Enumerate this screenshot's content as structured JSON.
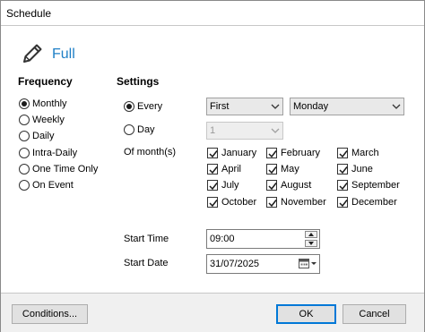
{
  "window": {
    "title": "Schedule"
  },
  "header": {
    "mode_label": "Full",
    "icon": "pencil-icon"
  },
  "frequency": {
    "heading": "Frequency",
    "selected": "Monthly",
    "options": [
      "Monthly",
      "Weekly",
      "Daily",
      "Intra-Daily",
      "One Time Only",
      "On Event"
    ]
  },
  "settings": {
    "heading": "Settings",
    "every_label": "Every",
    "day_label": "Day",
    "every_selected": true,
    "ordinal_value": "First",
    "weekday_value": "Monday",
    "day_value": "1",
    "months_label": "Of month(s)",
    "months": [
      "January",
      "February",
      "March",
      "April",
      "May",
      "June",
      "July",
      "August",
      "September",
      "October",
      "November",
      "December"
    ],
    "months_checked": [
      true,
      true,
      true,
      true,
      true,
      true,
      true,
      true,
      true,
      true,
      true,
      true
    ]
  },
  "start": {
    "time_label": "Start Time",
    "time_value": "09:00",
    "date_label": "Start Date",
    "date_value": "31/07/2025"
  },
  "footer": {
    "conditions_label": "Conditions...",
    "ok_label": "OK",
    "cancel_label": "Cancel"
  },
  "colors": {
    "accent": "#1e7fc6",
    "default_button_border": "#0078d7",
    "footer_bg": "#f0f0f0"
  }
}
